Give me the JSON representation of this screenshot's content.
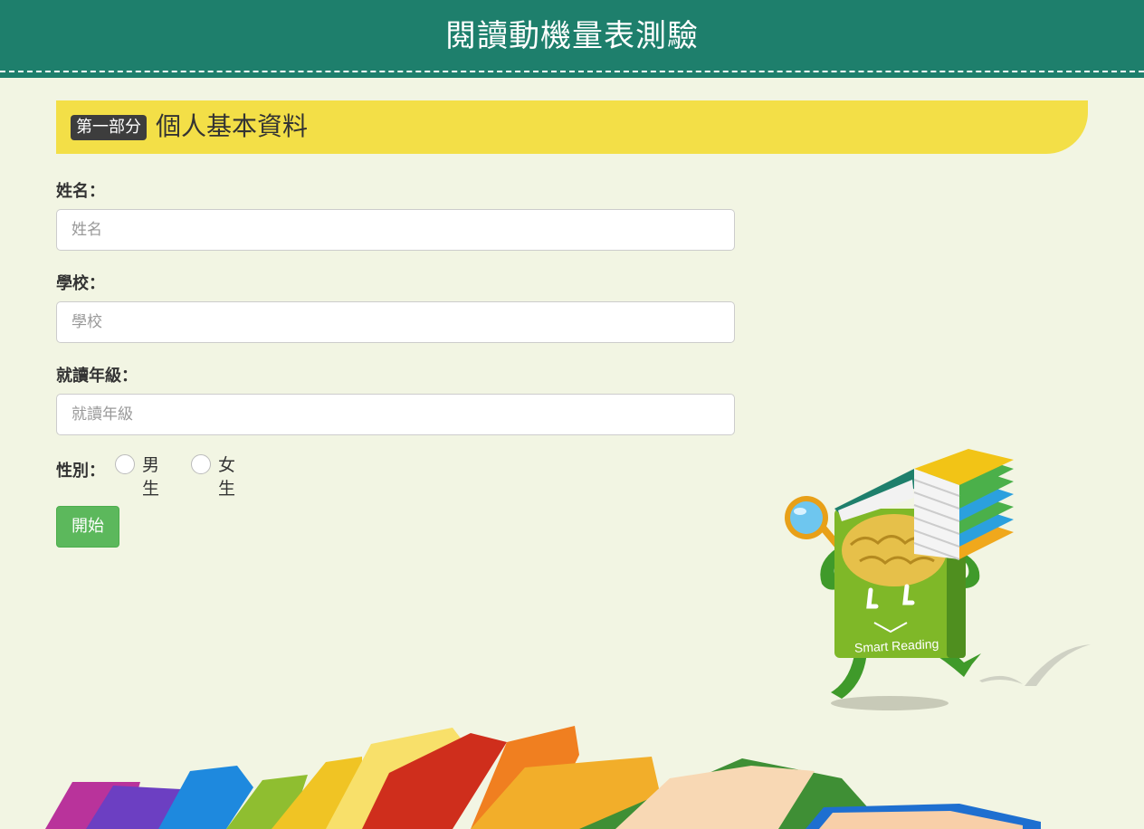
{
  "header": {
    "title": "閱讀動機量表測驗"
  },
  "section": {
    "badge": "第一部分",
    "title": "個人基本資料"
  },
  "form": {
    "name": {
      "label": "姓名：",
      "placeholder": "姓名",
      "value": ""
    },
    "school": {
      "label": "學校：",
      "placeholder": "學校",
      "value": ""
    },
    "grade": {
      "label": "就讀年級：",
      "placeholder": "就讀年級",
      "value": ""
    },
    "gender": {
      "label": "性別：",
      "options": [
        {
          "label": "男生",
          "selected": false
        },
        {
          "label": "女生",
          "selected": false
        }
      ]
    },
    "start_label": "開始"
  },
  "mascot": {
    "text": "Smart Reading"
  },
  "colors": {
    "header_bg": "#1e7f6c",
    "page_bg": "#f2f5e3",
    "section_bar": "#f3df47",
    "badge_bg": "#3d3d3d",
    "start_button": "#5cb85c"
  }
}
